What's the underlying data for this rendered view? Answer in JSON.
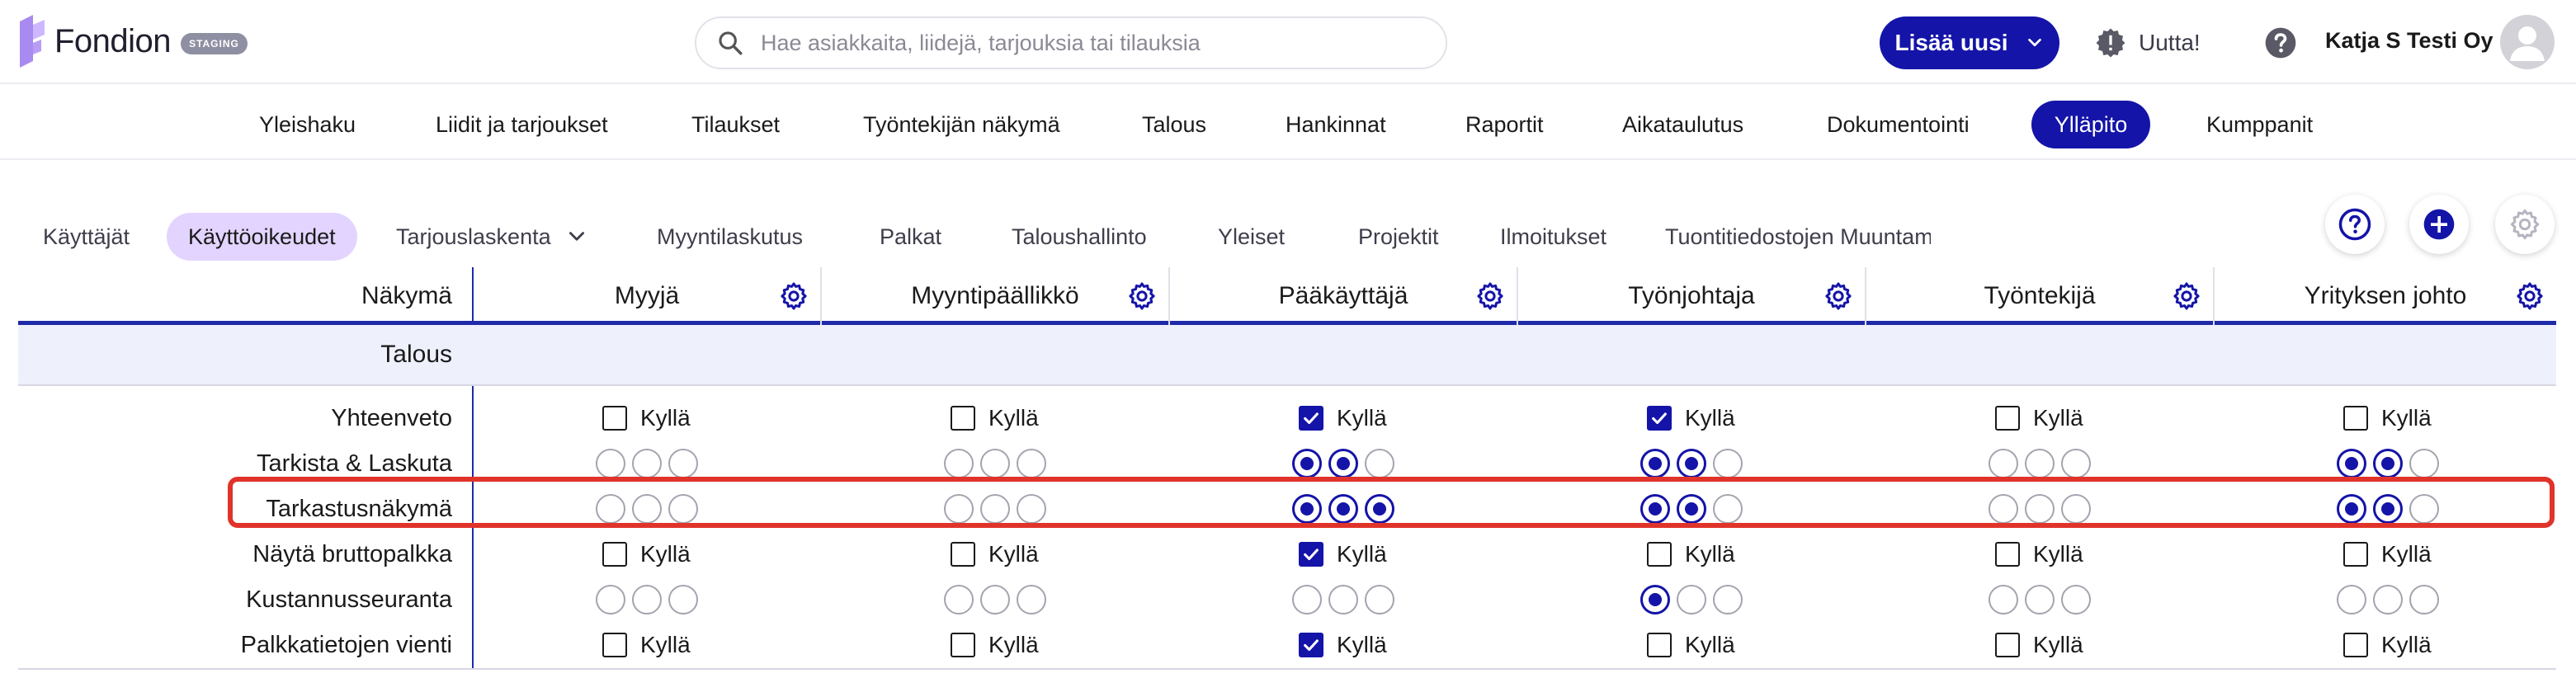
{
  "app": {
    "name": "Fondion",
    "env_badge": "STAGING"
  },
  "search": {
    "placeholder": "Hae asiakkaita, liidejä, tarjouksia tai tilauksia"
  },
  "header": {
    "add_new_label": "Lisää uusi",
    "news_label": "Uutta!",
    "user_name": "Katja S Testi Oy"
  },
  "main_nav": [
    {
      "label": "Yleishaku",
      "active": false
    },
    {
      "label": "Liidit ja tarjoukset",
      "active": false
    },
    {
      "label": "Tilaukset",
      "active": false
    },
    {
      "label": "Työntekijän näkymä",
      "active": false
    },
    {
      "label": "Talous",
      "active": false
    },
    {
      "label": "Hankinnat",
      "active": false
    },
    {
      "label": "Raportit",
      "active": false
    },
    {
      "label": "Aikataulutus",
      "active": false
    },
    {
      "label": "Dokumentointi",
      "active": false
    },
    {
      "label": "Ylläpito",
      "active": true
    },
    {
      "label": "Kumppanit",
      "active": false
    }
  ],
  "sub_tabs": [
    {
      "label": "Käyttäjät",
      "active": false
    },
    {
      "label": "Käyttöoikeudet",
      "active": true
    },
    {
      "label": "Tarjouslaskenta",
      "active": false,
      "dropdown": true
    },
    {
      "label": "Myyntilaskutus",
      "active": false
    },
    {
      "label": "Palkat",
      "active": false
    },
    {
      "label": "Taloushallinto",
      "active": false
    },
    {
      "label": "Yleiset",
      "active": false
    },
    {
      "label": "Projektit",
      "active": false
    },
    {
      "label": "Ilmoitukset",
      "active": false
    },
    {
      "label": "Tuontitiedostojen Muuntaminen",
      "active": false
    }
  ],
  "table": {
    "view_header": "Näkymä",
    "roles": [
      "Myyjä",
      "Myyntipäällikkö",
      "Pääkäyttäjä",
      "Työnjohtaja",
      "Työntekijä",
      "Yrityksen johto"
    ],
    "section": "Talous",
    "checkbox_label": "Kyllä",
    "rows": [
      {
        "label": "Yhteenveto",
        "type": "checkbox",
        "values": [
          false,
          false,
          true,
          true,
          false,
          false
        ]
      },
      {
        "label": "Tarkista & Laskuta",
        "type": "radio",
        "values": [
          [
            false,
            false,
            false
          ],
          [
            false,
            false,
            false
          ],
          [
            true,
            true,
            false
          ],
          [
            true,
            true,
            false
          ],
          [
            false,
            false,
            false
          ],
          [
            true,
            true,
            false
          ]
        ]
      },
      {
        "label": "Tarkastusnäkymä",
        "type": "radio",
        "highlighted": true,
        "values": [
          [
            false,
            false,
            false
          ],
          [
            false,
            false,
            false
          ],
          [
            true,
            true,
            true
          ],
          [
            true,
            true,
            false
          ],
          [
            false,
            false,
            false
          ],
          [
            true,
            true,
            false
          ]
        ]
      },
      {
        "label": "Näytä bruttopalkka",
        "type": "checkbox",
        "values": [
          false,
          false,
          true,
          false,
          false,
          false
        ]
      },
      {
        "label": "Kustannusseuranta",
        "type": "radio",
        "values": [
          [
            false,
            false,
            false
          ],
          [
            false,
            false,
            false
          ],
          [
            false,
            false,
            false
          ],
          [
            true,
            false,
            false
          ],
          [
            false,
            false,
            false
          ],
          [
            false,
            false,
            false
          ]
        ]
      },
      {
        "label": "Palkkatietojen vienti",
        "type": "checkbox",
        "values": [
          false,
          false,
          true,
          false,
          false,
          false
        ]
      }
    ]
  },
  "colors": {
    "brand": "#1414a8",
    "active_subtab": "#e2d4ff",
    "highlight": "#e0332a",
    "section_bg": "#eef0fb"
  }
}
